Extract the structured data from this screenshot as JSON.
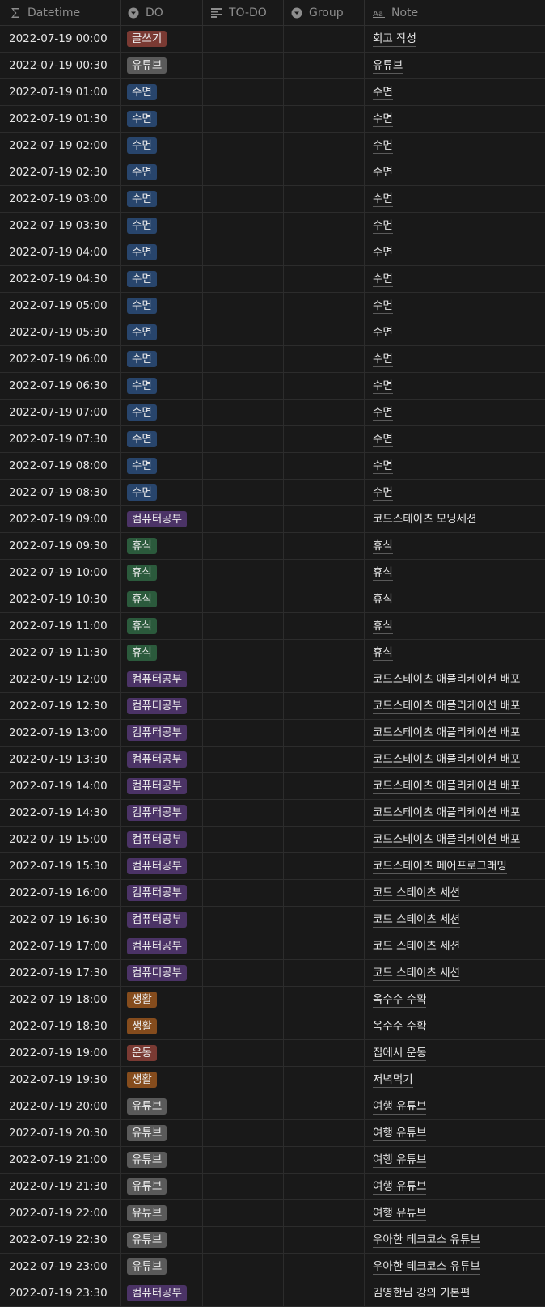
{
  "columns": [
    {
      "label": "Datetime",
      "icon": "formula-icon"
    },
    {
      "label": "DO",
      "icon": "select-icon"
    },
    {
      "label": "TO-DO",
      "icon": "text-icon"
    },
    {
      "label": "Group",
      "icon": "select-icon"
    },
    {
      "label": "Note",
      "icon": "title-icon"
    }
  ],
  "tag_colors": {
    "글쓰기": "#7a3a33",
    "유튜브": "#5a5a5a",
    "수면": "#28456c",
    "컴퓨터공부": "#4b3366",
    "휴식": "#2b5a3c",
    "생활": "#854c1d",
    "운동": "#7a3a33"
  },
  "rows": [
    {
      "datetime": "2022-07-19 00:00",
      "do": "글쓰기",
      "note": "회고 작성"
    },
    {
      "datetime": "2022-07-19 00:30",
      "do": "유튜브",
      "note": "유튜브"
    },
    {
      "datetime": "2022-07-19 01:00",
      "do": "수면",
      "note": "수면"
    },
    {
      "datetime": "2022-07-19 01:30",
      "do": "수면",
      "note": "수면"
    },
    {
      "datetime": "2022-07-19 02:00",
      "do": "수면",
      "note": "수면"
    },
    {
      "datetime": "2022-07-19 02:30",
      "do": "수면",
      "note": "수면"
    },
    {
      "datetime": "2022-07-19 03:00",
      "do": "수면",
      "note": "수면"
    },
    {
      "datetime": "2022-07-19 03:30",
      "do": "수면",
      "note": "수면"
    },
    {
      "datetime": "2022-07-19 04:00",
      "do": "수면",
      "note": "수면"
    },
    {
      "datetime": "2022-07-19 04:30",
      "do": "수면",
      "note": "수면"
    },
    {
      "datetime": "2022-07-19 05:00",
      "do": "수면",
      "note": "수면"
    },
    {
      "datetime": "2022-07-19 05:30",
      "do": "수면",
      "note": "수면"
    },
    {
      "datetime": "2022-07-19 06:00",
      "do": "수면",
      "note": "수면"
    },
    {
      "datetime": "2022-07-19 06:30",
      "do": "수면",
      "note": "수면"
    },
    {
      "datetime": "2022-07-19 07:00",
      "do": "수면",
      "note": "수면"
    },
    {
      "datetime": "2022-07-19 07:30",
      "do": "수면",
      "note": "수면"
    },
    {
      "datetime": "2022-07-19 08:00",
      "do": "수면",
      "note": "수면"
    },
    {
      "datetime": "2022-07-19 08:30",
      "do": "수면",
      "note": "수면"
    },
    {
      "datetime": "2022-07-19 09:00",
      "do": "컴퓨터공부",
      "note": "코드스테이츠 모닝세션"
    },
    {
      "datetime": "2022-07-19 09:30",
      "do": "휴식",
      "note": "휴식"
    },
    {
      "datetime": "2022-07-19 10:00",
      "do": "휴식",
      "note": "휴식"
    },
    {
      "datetime": "2022-07-19 10:30",
      "do": "휴식",
      "note": "휴식"
    },
    {
      "datetime": "2022-07-19 11:00",
      "do": "휴식",
      "note": "휴식"
    },
    {
      "datetime": "2022-07-19 11:30",
      "do": "휴식",
      "note": "휴식"
    },
    {
      "datetime": "2022-07-19 12:00",
      "do": "컴퓨터공부",
      "note": "코드스테이츠 애플리케이션 배포"
    },
    {
      "datetime": "2022-07-19 12:30",
      "do": "컴퓨터공부",
      "note": "코드스테이츠 애플리케이션 배포"
    },
    {
      "datetime": "2022-07-19 13:00",
      "do": "컴퓨터공부",
      "note": "코드스테이츠 애플리케이션 배포"
    },
    {
      "datetime": "2022-07-19 13:30",
      "do": "컴퓨터공부",
      "note": "코드스테이츠 애플리케이션 배포"
    },
    {
      "datetime": "2022-07-19 14:00",
      "do": "컴퓨터공부",
      "note": "코드스테이츠 애플리케이션 배포"
    },
    {
      "datetime": "2022-07-19 14:30",
      "do": "컴퓨터공부",
      "note": "코드스테이츠 애플리케이션 배포"
    },
    {
      "datetime": "2022-07-19 15:00",
      "do": "컴퓨터공부",
      "note": "코드스테이츠 애플리케이션 배포"
    },
    {
      "datetime": "2022-07-19 15:30",
      "do": "컴퓨터공부",
      "note": "코드스테이츠 페어프로그래밍"
    },
    {
      "datetime": "2022-07-19 16:00",
      "do": "컴퓨터공부",
      "note": "코드 스테이츠 세션"
    },
    {
      "datetime": "2022-07-19 16:30",
      "do": "컴퓨터공부",
      "note": "코드 스테이츠 세션"
    },
    {
      "datetime": "2022-07-19 17:00",
      "do": "컴퓨터공부",
      "note": "코드 스테이츠 세션"
    },
    {
      "datetime": "2022-07-19 17:30",
      "do": "컴퓨터공부",
      "note": "코드 스테이츠 세션"
    },
    {
      "datetime": "2022-07-19 18:00",
      "do": "생활",
      "note": "옥수수 수확"
    },
    {
      "datetime": "2022-07-19 18:30",
      "do": "생활",
      "note": "옥수수 수확"
    },
    {
      "datetime": "2022-07-19 19:00",
      "do": "운동",
      "note": "집에서 운동"
    },
    {
      "datetime": "2022-07-19 19:30",
      "do": "생활",
      "note": "저녁먹기"
    },
    {
      "datetime": "2022-07-19 20:00",
      "do": "유튜브",
      "note": "여행 유튜브"
    },
    {
      "datetime": "2022-07-19 20:30",
      "do": "유튜브",
      "note": "여행 유튜브"
    },
    {
      "datetime": "2022-07-19 21:00",
      "do": "유튜브",
      "note": "여행 유튜브"
    },
    {
      "datetime": "2022-07-19 21:30",
      "do": "유튜브",
      "note": "여행 유튜브"
    },
    {
      "datetime": "2022-07-19 22:00",
      "do": "유튜브",
      "note": "여행 유튜브"
    },
    {
      "datetime": "2022-07-19 22:30",
      "do": "유튜브",
      "note": "우아한 테크코스 유튜브"
    },
    {
      "datetime": "2022-07-19 23:00",
      "do": "유튜브",
      "note": "우아한 테크코스 유튜브"
    },
    {
      "datetime": "2022-07-19 23:30",
      "do": "컴퓨터공부",
      "note": "김영한님 강의 기본편"
    }
  ]
}
